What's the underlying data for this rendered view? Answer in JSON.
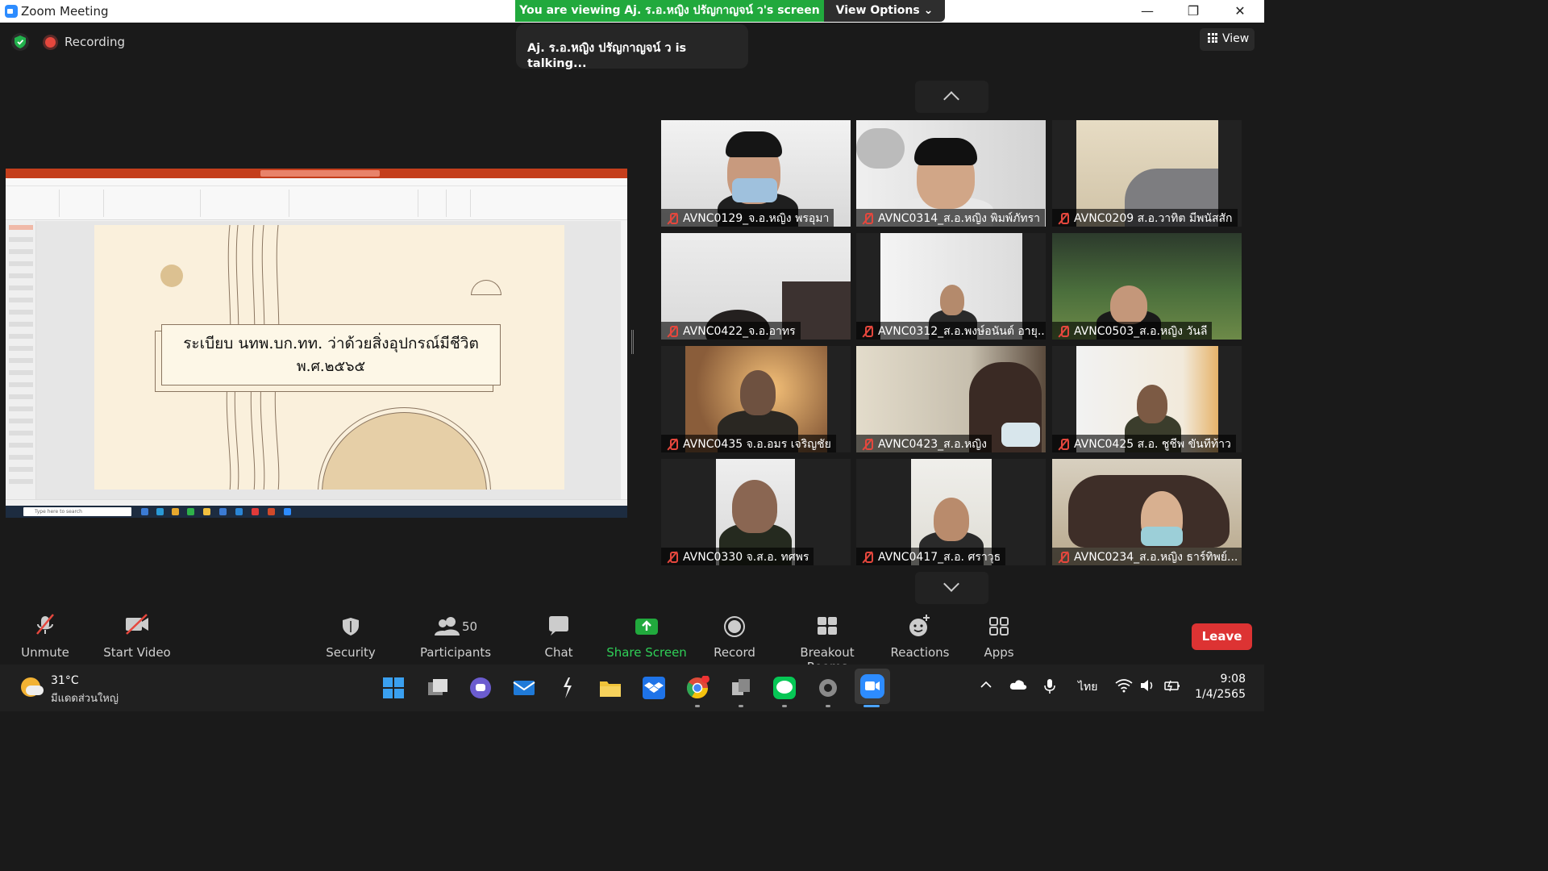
{
  "window": {
    "title": "Zoom Meeting",
    "viewing_banner": "You are viewing Aj. ร.อ.หญิง ปรัญกาญจน์ ว's screen",
    "view_options": "View Options ⌄"
  },
  "meeting": {
    "recording_label": "Recording",
    "talking_text": "Aj. ร.อ.หญิง ปรัญกาญจน์ ว is talking...",
    "view_label": "View"
  },
  "slide": {
    "line1": "ระเบียบ นทพ.บก.ทท. ว่าด้วยสิ่งอุปกรณ์มีชีวิต",
    "line2": "พ.ศ.๒๕๖๕",
    "small_search_text": "Type here to search"
  },
  "participants": [
    {
      "name": "AVNC0129_จ.อ.หญิง พรอุมา"
    },
    {
      "name": "AVNC0314_ส.อ.หญิง พิมพ์ภัทรา"
    },
    {
      "name": "AVNC0209 ส.อ.วาทิต มีพนัสสัก"
    },
    {
      "name": "AVNC0422_จ.อ.อาทร"
    },
    {
      "name": "AVNC0312_ส.อ.พงษ์อนันต์ อายุ..."
    },
    {
      "name": "AVNC0503_ส.อ.หญิง วันลี"
    },
    {
      "name": "AVNC0435 จ.อ.อมร เจริญชัย"
    },
    {
      "name": "AVNC0423_ส.อ.หญิง"
    },
    {
      "name": "AVNC0425 ส.อ. ชูชีพ ขันทีท้าว"
    },
    {
      "name": "AVNC0330 จ.ส.อ. ทศพร"
    },
    {
      "name": "AVNC0417_ส.อ. ศราวุธ"
    },
    {
      "name": "AVNC0234_ส.อ.หญิง ธาร์ทิพย์..."
    }
  ],
  "toolbar": {
    "unmute": "Unmute",
    "start_video": "Start Video",
    "security": "Security",
    "participants": "Participants",
    "participants_count": "50",
    "chat": "Chat",
    "share_screen": "Share Screen",
    "record": "Record",
    "breakout_rooms": "Breakout Rooms",
    "reactions": "Reactions",
    "apps": "Apps",
    "leave": "Leave"
  },
  "taskbar": {
    "temperature": "31°C",
    "weather": "มีแดดส่วนใหญ่",
    "language": "ไทย",
    "time": "9:08",
    "date": "1/4/2565"
  },
  "colors": {
    "green_banner": "#21a93d",
    "leave_red": "#dd3333",
    "share_green": "#21a93d",
    "mute_red": "#e5473d"
  }
}
